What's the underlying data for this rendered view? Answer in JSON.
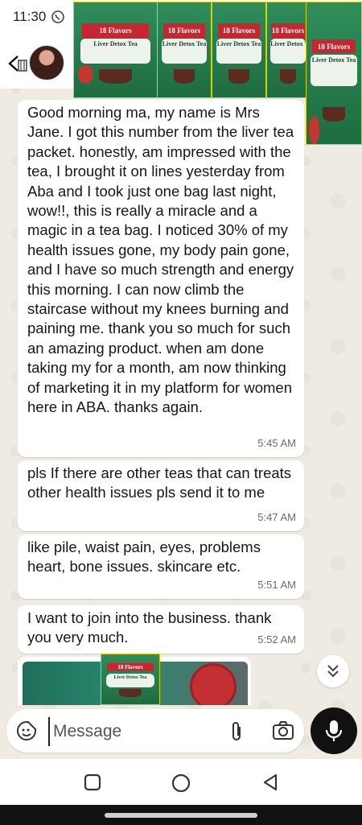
{
  "status_bar": {
    "time": "11:30"
  },
  "product": {
    "brand": "18 Flavors",
    "name": "Liver Detox Tea"
  },
  "messages": [
    {
      "text": "Good morning ma, my name is Mrs Jane. I got this number from the  liver tea packet. honestly, am impressed with the tea, I brought it on lines yesterday from Aba and I took just one bag last night, wow!!, this is really a miracle and a magic in a tea bag. I noticed  30% of my health issues gone, my body pain gone, and I have so much strength and energy this morning. I can now climb the staircase without my knees burning and paining me. thank you so much for such an amazing product. when am done taking my for a month, am now thinking of marketing it in my platform for women here in ABA. thanks again.",
      "time": "5:45 AM"
    },
    {
      "text": "pls If there are other teas that can treats other health issues pls send it to me",
      "time": "5:47 AM"
    },
    {
      "text": "like pile, waist pain, eyes, problems heart, bone issues. skincare etc.",
      "time": "5:51 AM"
    },
    {
      "text": "I want to join into the business. thank you very much.",
      "time": "5:52 AM"
    }
  ],
  "composer": {
    "placeholder": "Message"
  },
  "icons": {
    "back": "back-arrow-icon",
    "sticker": "sticker-icon",
    "attach": "paperclip-icon",
    "camera": "camera-icon",
    "mic": "microphone-icon",
    "scroll": "double-chevron-down-icon"
  },
  "colors": {
    "chat_background": "#efeae2",
    "bubble": "#ffffff",
    "mic_button": "#111111",
    "product_green": "#2f8e5b",
    "product_red": "#c8252e"
  }
}
